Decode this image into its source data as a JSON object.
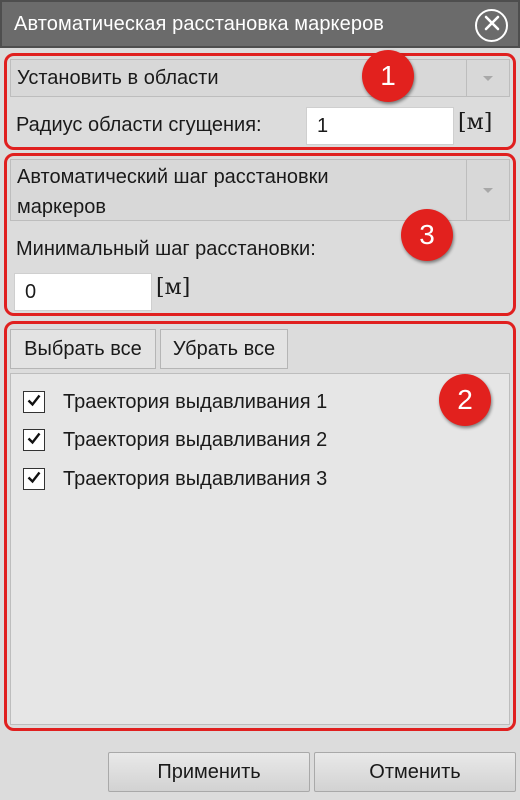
{
  "window": {
    "title": "Автоматическая расстановка маркеров",
    "close_icon": "close-circle-icon"
  },
  "placement": {
    "mode_value": "Установить в области",
    "radius_label": "Радиус области сгущения:",
    "radius_value": "1",
    "radius_unit": "[м]"
  },
  "step": {
    "mode_value": "Автоматический шаг расстановки маркеров",
    "min_step_label": "Минимальный шаг расстановки:",
    "min_step_value": "0",
    "min_step_unit": "[м]"
  },
  "selection": {
    "select_all_label": "Выбрать все",
    "deselect_all_label": "Убрать все",
    "items": [
      {
        "label": "Траектория выдавливания 1",
        "checked": true
      },
      {
        "label": "Траектория выдавливания 2",
        "checked": true
      },
      {
        "label": "Траектория выдавливания 3",
        "checked": true
      }
    ]
  },
  "badges": {
    "b1": "1",
    "b2": "2",
    "b3": "3"
  },
  "footer": {
    "apply_label": "Применить",
    "cancel_label": "Отменить"
  },
  "colors": {
    "annotation_red": "#e0201f",
    "titlebar": "#6b6b6b",
    "background": "#dcdcdc"
  }
}
